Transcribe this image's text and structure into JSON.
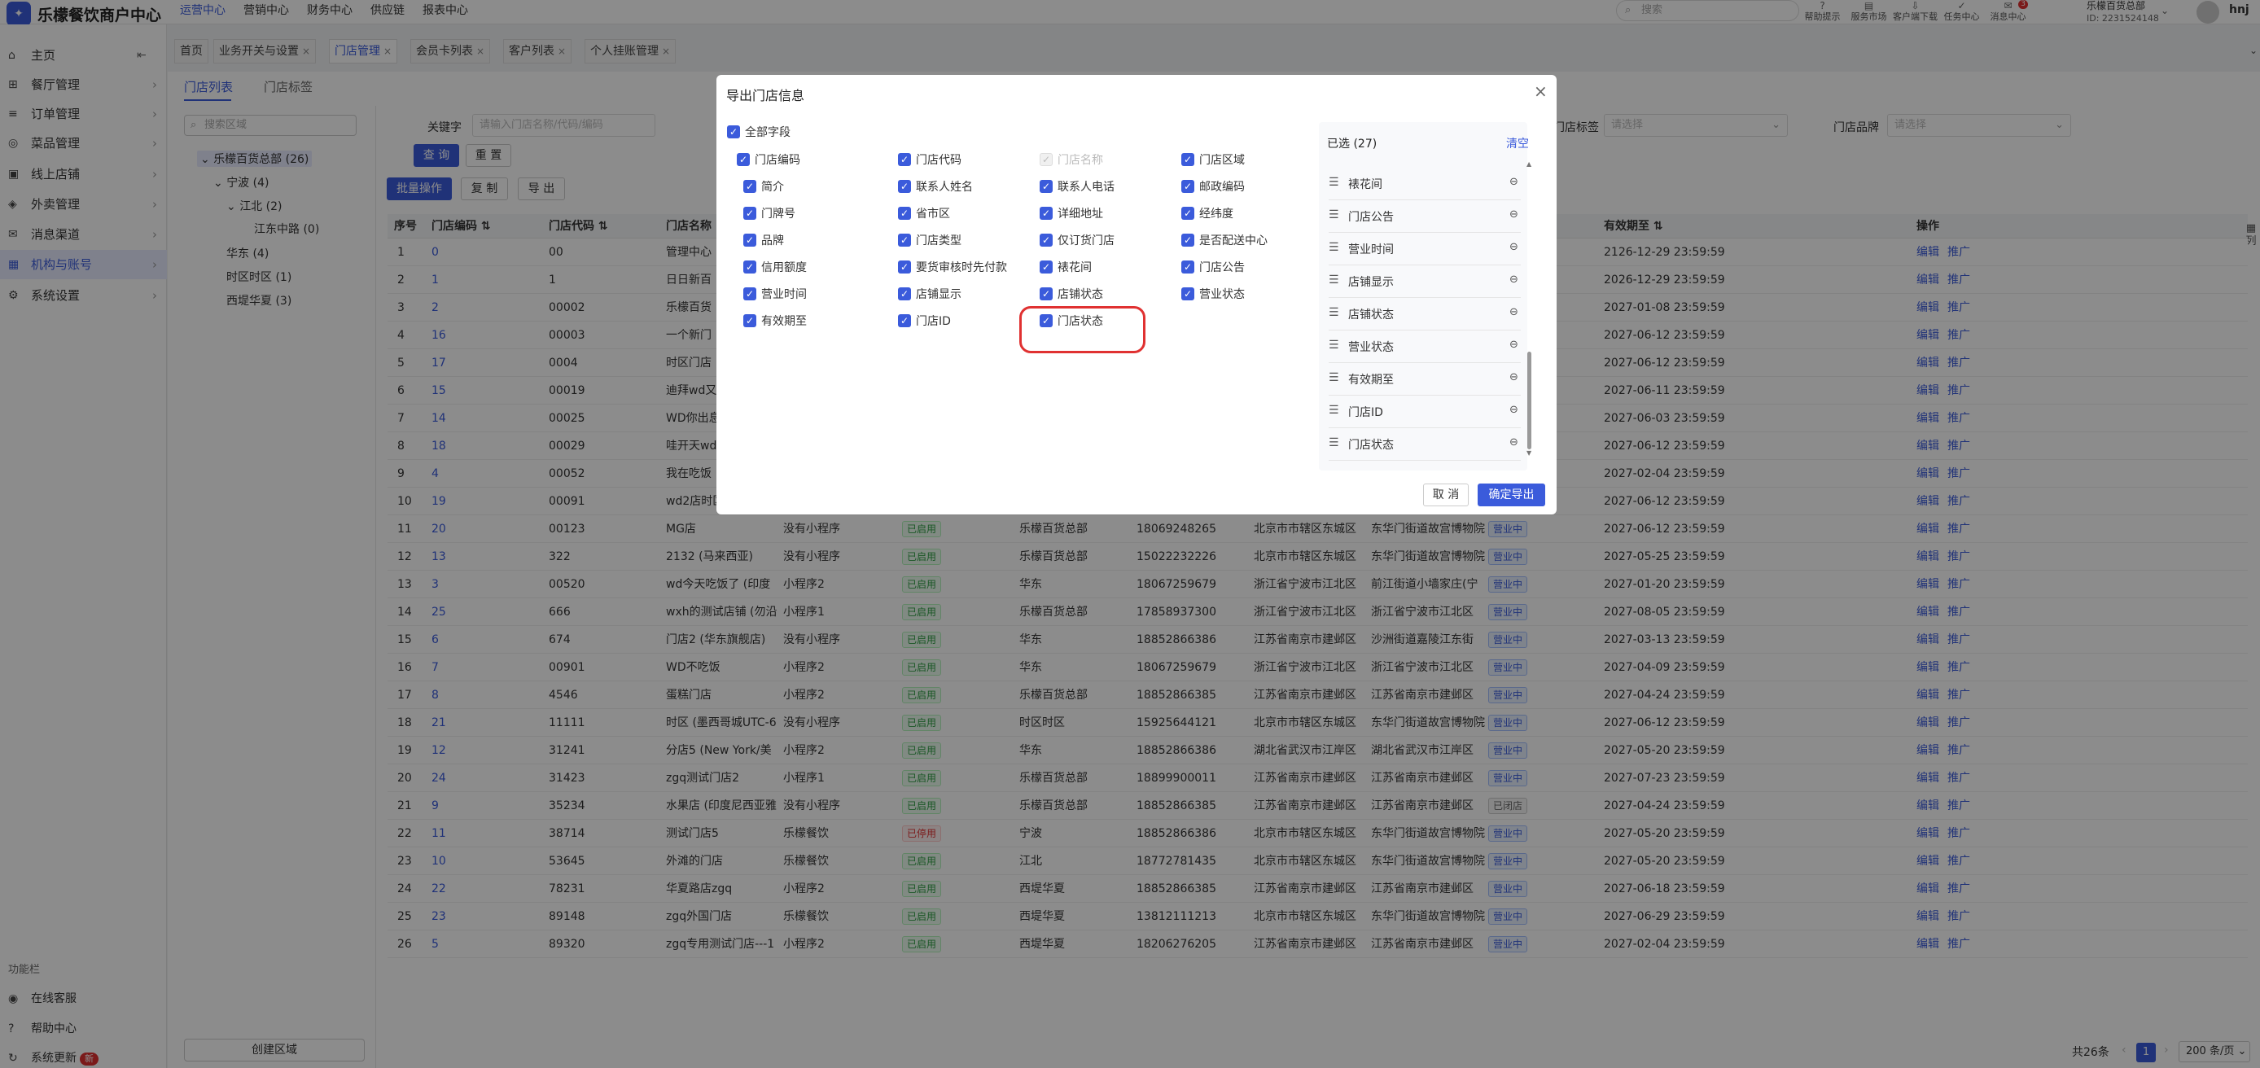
{
  "app": {
    "title": "乐檬餐饮商户中心",
    "logo_glyph": "✦"
  },
  "topnav": {
    "items": [
      "运营中心",
      "营销中心",
      "财务中心",
      "供应链",
      "报表中心"
    ]
  },
  "topsearch": {
    "placeholder": "搜索"
  },
  "tools": [
    {
      "glyph": "?",
      "label": "帮助提示"
    },
    {
      "glyph": "▤",
      "label": "服务市场"
    },
    {
      "glyph": "⇩",
      "label": "客户端下载"
    },
    {
      "glyph": "✓",
      "label": "任务中心"
    },
    {
      "glyph": "✉",
      "label": "消息中心",
      "badge": "3"
    }
  ],
  "account": {
    "name": "乐檬百货总部",
    "id": "ID: 2231524148",
    "user": "hnj"
  },
  "sidebar": {
    "items": [
      {
        "label": "主页",
        "icon": "home-icon",
        "glyph": "⌂"
      },
      {
        "label": "餐厅管理",
        "icon": "store-icon",
        "glyph": "⊞"
      },
      {
        "label": "订单管理",
        "icon": "order-icon",
        "glyph": "≡"
      },
      {
        "label": "菜品管理",
        "icon": "dish-icon",
        "glyph": "◎"
      },
      {
        "label": "线上店铺",
        "icon": "shop-icon",
        "glyph": "▣"
      },
      {
        "label": "外卖管理",
        "icon": "delivery-icon",
        "glyph": "◈"
      },
      {
        "label": "消息渠道",
        "icon": "message-icon",
        "glyph": "✉"
      },
      {
        "label": "机构与账号",
        "icon": "org-icon",
        "glyph": "▦"
      },
      {
        "label": "系统设置",
        "icon": "settings-icon",
        "glyph": "⚙"
      }
    ],
    "section": "功能栏",
    "bottom": [
      {
        "label": "在线客服",
        "glyph": "◉"
      },
      {
        "label": "帮助中心",
        "glyph": "?"
      },
      {
        "label": "系统更新",
        "glyph": "↻",
        "badge": "新"
      }
    ]
  },
  "tabs": [
    {
      "label": "首页",
      "closable": false
    },
    {
      "label": "业务开关与设置",
      "closable": true
    },
    {
      "label": "门店管理",
      "closable": true,
      "active": true
    },
    {
      "label": "会员卡列表",
      "closable": true
    },
    {
      "label": "客户列表",
      "closable": true
    },
    {
      "label": "个人挂账管理",
      "closable": true
    }
  ],
  "subtabs": [
    "门店列表",
    "门店标签"
  ],
  "tree": {
    "search_placeholder": "搜索区域",
    "nodes": [
      "乐檬百货总部 (26)",
      "宁波 (4)",
      "江北 (2)",
      "江东中路 (0)",
      "华东 (4)",
      "时区时区 (1)",
      "西堤华夏 (3)"
    ],
    "create": "创建区域"
  },
  "filters": {
    "keyword_label": "关键字",
    "keyword_placeholder": "请输入门店名称/代码/编码",
    "tag_label": "门店标签",
    "tag_placeholder": "请选择",
    "brand_label": "门店品牌",
    "brand_placeholder": "请选择",
    "query": "查 询",
    "reset": "重 置",
    "batch": "批量操作",
    "copy": "复 制",
    "export": "导 出"
  },
  "table": {
    "headers": [
      "序号",
      "门店编码",
      "门店代码",
      "门店名称",
      "有效期至",
      "操作"
    ],
    "rows": [
      {
        "seq": "1",
        "code": "0",
        "dcode": "00",
        "name": "管理中心",
        "type": "",
        "status": "",
        "region": "",
        "phone": "",
        "area": "",
        "addr": "",
        "op": "",
        "exp": "2126-12-29 23:59:59"
      },
      {
        "seq": "2",
        "code": "1",
        "dcode": "1",
        "name": "日日新百",
        "type": "",
        "status": "",
        "region": "",
        "phone": "",
        "area": "",
        "addr": "",
        "op": "",
        "exp": "2026-12-29 23:59:59"
      },
      {
        "seq": "3",
        "code": "2",
        "dcode": "00002",
        "name": "乐檬百货",
        "type": "",
        "status": "",
        "region": "",
        "phone": "",
        "area": "",
        "addr": "",
        "op": "",
        "exp": "2027-01-08 23:59:59"
      },
      {
        "seq": "4",
        "code": "16",
        "dcode": "00003",
        "name": "一个新门",
        "type": "",
        "status": "",
        "region": "",
        "phone": "",
        "area": "",
        "addr": "",
        "op": "",
        "exp": "2027-06-12 23:59:59"
      },
      {
        "seq": "5",
        "code": "17",
        "dcode": "0004",
        "name": "时区门店",
        "type": "",
        "status": "",
        "region": "",
        "phone": "",
        "area": "",
        "addr": "",
        "op": "",
        "exp": "2027-06-12 23:59:59"
      },
      {
        "seq": "6",
        "code": "15",
        "dcode": "00019",
        "name": "迪拜wd又",
        "type": "",
        "status": "",
        "region": "",
        "phone": "",
        "area": "",
        "addr": "",
        "op": "",
        "exp": "2027-06-11 23:59:59"
      },
      {
        "seq": "7",
        "code": "14",
        "dcode": "00025",
        "name": "WD你出息",
        "type": "",
        "status": "",
        "region": "",
        "phone": "",
        "area": "",
        "addr": "",
        "op": "",
        "exp": "2027-06-03 23:59:59"
      },
      {
        "seq": "8",
        "code": "18",
        "dcode": "00029",
        "name": "哇开天wd",
        "type": "",
        "status": "",
        "region": "",
        "phone": "",
        "area": "",
        "addr": "",
        "op": "",
        "exp": "2027-06-12 23:59:59"
      },
      {
        "seq": "9",
        "code": "4",
        "dcode": "00052",
        "name": "我在吃饭",
        "type": "",
        "status": "",
        "region": "",
        "phone": "",
        "area": "",
        "addr": "",
        "op": "",
        "exp": "2027-02-04 23:59:59"
      },
      {
        "seq": "10",
        "code": "19",
        "dcode": "00091",
        "name": "wd2店时区",
        "type": "",
        "status": "",
        "region": "",
        "phone": "",
        "area": "",
        "addr": "",
        "op": "",
        "exp": "2027-06-12 23:59:59"
      },
      {
        "seq": "11",
        "code": "20",
        "dcode": "00123",
        "name": "MG店",
        "type": "没有小程序",
        "status": "已启用",
        "region": "乐檬百货总部",
        "phone": "18069248265",
        "area": "北京市市辖区东城区",
        "addr": "东华门街道故宫博物院",
        "op": "营业中",
        "exp": "2027-06-12 23:59:59"
      },
      {
        "seq": "12",
        "code": "13",
        "dcode": "322",
        "name": "2132 (马来西亚)",
        "type": "没有小程序",
        "status": "已启用",
        "region": "乐檬百货总部",
        "phone": "15022232226",
        "area": "北京市市辖区东城区",
        "addr": "东华门街道故宫博物院",
        "op": "营业中",
        "exp": "2027-05-25 23:59:59"
      },
      {
        "seq": "13",
        "code": "3",
        "dcode": "00520",
        "name": "wd今天吃饭了 (印度",
        "type": "小程序2",
        "status": "已启用",
        "region": "华东",
        "phone": "18067259679",
        "area": "浙江省宁波市江北区",
        "addr": "前江街道小墙家庄(宁",
        "op": "营业中",
        "exp": "2027-01-20 23:59:59"
      },
      {
        "seq": "14",
        "code": "25",
        "dcode": "666",
        "name": "wxh的测试店铺 (勿沿",
        "type": "小程序1",
        "status": "已启用",
        "region": "乐檬百货总部",
        "phone": "17858937300",
        "area": "浙江省宁波市江北区",
        "addr": "浙江省宁波市江北区",
        "op": "营业中",
        "exp": "2027-08-05 23:59:59"
      },
      {
        "seq": "15",
        "code": "6",
        "dcode": "674",
        "name": "门店2 (华东旗舰店)",
        "type": "没有小程序",
        "status": "已启用",
        "region": "华东",
        "phone": "18852866386",
        "area": "江苏省南京市建邺区",
        "addr": "沙洲街道嘉陵江东街",
        "op": "营业中",
        "exp": "2027-03-13 23:59:59"
      },
      {
        "seq": "16",
        "code": "7",
        "dcode": "00901",
        "name": "WD不吃饭",
        "type": "小程序2",
        "status": "已启用",
        "region": "华东",
        "phone": "18067259679",
        "area": "浙江省宁波市江北区",
        "addr": "浙江省宁波市江北区",
        "op": "营业中",
        "exp": "2027-04-09 23:59:59"
      },
      {
        "seq": "17",
        "code": "8",
        "dcode": "4546",
        "name": "蛋糕门店",
        "type": "小程序2",
        "status": "已启用",
        "region": "乐檬百货总部",
        "phone": "18852866385",
        "area": "江苏省南京市建邺区",
        "addr": "江苏省南京市建邺区",
        "op": "营业中",
        "exp": "2027-04-24 23:59:59"
      },
      {
        "seq": "18",
        "code": "21",
        "dcode": "11111",
        "name": "时区 (墨西哥城UTC-6",
        "type": "没有小程序",
        "status": "已启用",
        "region": "时区时区",
        "phone": "15925644121",
        "area": "北京市市辖区东城区",
        "addr": "东华门街道故宫博物院",
        "op": "营业中",
        "exp": "2027-06-12 23:59:59"
      },
      {
        "seq": "19",
        "code": "12",
        "dcode": "31241",
        "name": "分店5 (New York/美",
        "type": "小程序2",
        "status": "已启用",
        "region": "华东",
        "phone": "18852866386",
        "area": "湖北省武汉市江岸区",
        "addr": "湖北省武汉市江岸区",
        "op": "营业中",
        "exp": "2027-05-20 23:59:59"
      },
      {
        "seq": "20",
        "code": "24",
        "dcode": "31423",
        "name": "zgq测试门店2",
        "type": "小程序1",
        "status": "已启用",
        "region": "乐檬百货总部",
        "phone": "18899900011",
        "area": "江苏省南京市建邺区",
        "addr": "江苏省南京市建邺区",
        "op": "营业中",
        "exp": "2027-07-23 23:59:59"
      },
      {
        "seq": "21",
        "code": "9",
        "dcode": "35234",
        "name": "水果店 (印度尼西亚雅",
        "type": "没有小程序",
        "status": "已启用",
        "region": "乐檬百货总部",
        "phone": "18852866385",
        "area": "江苏省南京市建邺区",
        "addr": "江苏省南京市建邺区",
        "op": "已闭店",
        "exp": "2027-04-24 23:59:59"
      },
      {
        "seq": "22",
        "code": "11",
        "dcode": "38714",
        "name": "测试门店5",
        "type": "乐檬餐饮",
        "status": "已停用",
        "region": "宁波",
        "phone": "18852866386",
        "area": "北京市市辖区东城区",
        "addr": "东华门街道故宫博物院",
        "op": "营业中",
        "exp": "2027-05-20 23:59:59"
      },
      {
        "seq": "23",
        "code": "10",
        "dcode": "53645",
        "name": "外滩的门店",
        "type": "乐檬餐饮",
        "status": "已启用",
        "region": "江北",
        "phone": "18772781435",
        "area": "北京市市辖区东城区",
        "addr": "东华门街道故宫博物院",
        "op": "营业中",
        "exp": "2027-05-20 23:59:59"
      },
      {
        "seq": "24",
        "code": "22",
        "dcode": "78231",
        "name": "华夏路店zgq",
        "type": "小程序2",
        "status": "已启用",
        "region": "西堤华夏",
        "phone": "18852866385",
        "area": "江苏省南京市建邺区",
        "addr": "江苏省南京市建邺区",
        "op": "营业中",
        "exp": "2027-06-18 23:59:59"
      },
      {
        "seq": "25",
        "code": "23",
        "dcode": "89148",
        "name": "zgq外国门店",
        "type": "乐檬餐饮",
        "status": "已启用",
        "region": "西堤华夏",
        "phone": "13812111213",
        "area": "北京市市辖区东城区",
        "addr": "东华门街道故宫博物院",
        "op": "营业中",
        "exp": "2027-06-29 23:59:59"
      },
      {
        "seq": "26",
        "code": "5",
        "dcode": "89320",
        "name": "zgq专用测试门店---1",
        "type": "小程序2",
        "status": "已启用",
        "region": "西堤华夏",
        "phone": "18206276205",
        "area": "江苏省南京市建邺区",
        "addr": "江苏省南京市建邺区",
        "op": "营业中",
        "exp": "2027-02-04 23:59:59"
      }
    ],
    "edit": "编辑",
    "promote": "推广",
    "colcfg": "列"
  },
  "pagination": {
    "total": "共26条",
    "page": "1",
    "size": "200 条/页"
  },
  "modal": {
    "title": "导出门店信息",
    "all_fields": "全部字段",
    "fields": [
      {
        "label": "门店编码",
        "checked": true
      },
      {
        "label": "门店代码",
        "checked": true
      },
      {
        "label": "门店名称",
        "checked": true,
        "disabled": true
      },
      {
        "label": "门店区域",
        "checked": true
      },
      {
        "label": "简介",
        "checked": true
      },
      {
        "label": "联系人姓名",
        "checked": true
      },
      {
        "label": "联系人电话",
        "checked": true
      },
      {
        "label": "邮政编码",
        "checked": true
      },
      {
        "label": "门牌号",
        "checked": true
      },
      {
        "label": "省市区",
        "checked": true
      },
      {
        "label": "详细地址",
        "checked": true
      },
      {
        "label": "经纬度",
        "checked": true
      },
      {
        "label": "品牌",
        "checked": true
      },
      {
        "label": "门店类型",
        "checked": true
      },
      {
        "label": "仅订货门店",
        "checked": true
      },
      {
        "label": "是否配送中心",
        "checked": true
      },
      {
        "label": "信用额度",
        "checked": true
      },
      {
        "label": "要货审核时先付款",
        "checked": true
      },
      {
        "label": "裱花间",
        "checked": true
      },
      {
        "label": "门店公告",
        "checked": true
      },
      {
        "label": "营业时间",
        "checked": true
      },
      {
        "label": "店铺显示",
        "checked": true
      },
      {
        "label": "店铺状态",
        "checked": true
      },
      {
        "label": "营业状态",
        "checked": true
      },
      {
        "label": "有效期至",
        "checked": true
      },
      {
        "label": "门店ID",
        "checked": true
      },
      {
        "label": "门店状态",
        "checked": true
      }
    ],
    "selected_title": "已选 (27)",
    "clear": "清空",
    "selected": [
      "裱花间",
      "门店公告",
      "营业时间",
      "店铺显示",
      "店铺状态",
      "营业状态",
      "有效期至",
      "门店ID",
      "门店状态"
    ],
    "cancel": "取 消",
    "confirm": "确定导出",
    "check_glyph": "✓",
    "drag_glyph": "☰",
    "remove_glyph": "⊖",
    "close_glyph": "×"
  },
  "colors": {
    "accent": "#3b5bdb",
    "success": "#2f9e44",
    "danger": "#e03131"
  }
}
